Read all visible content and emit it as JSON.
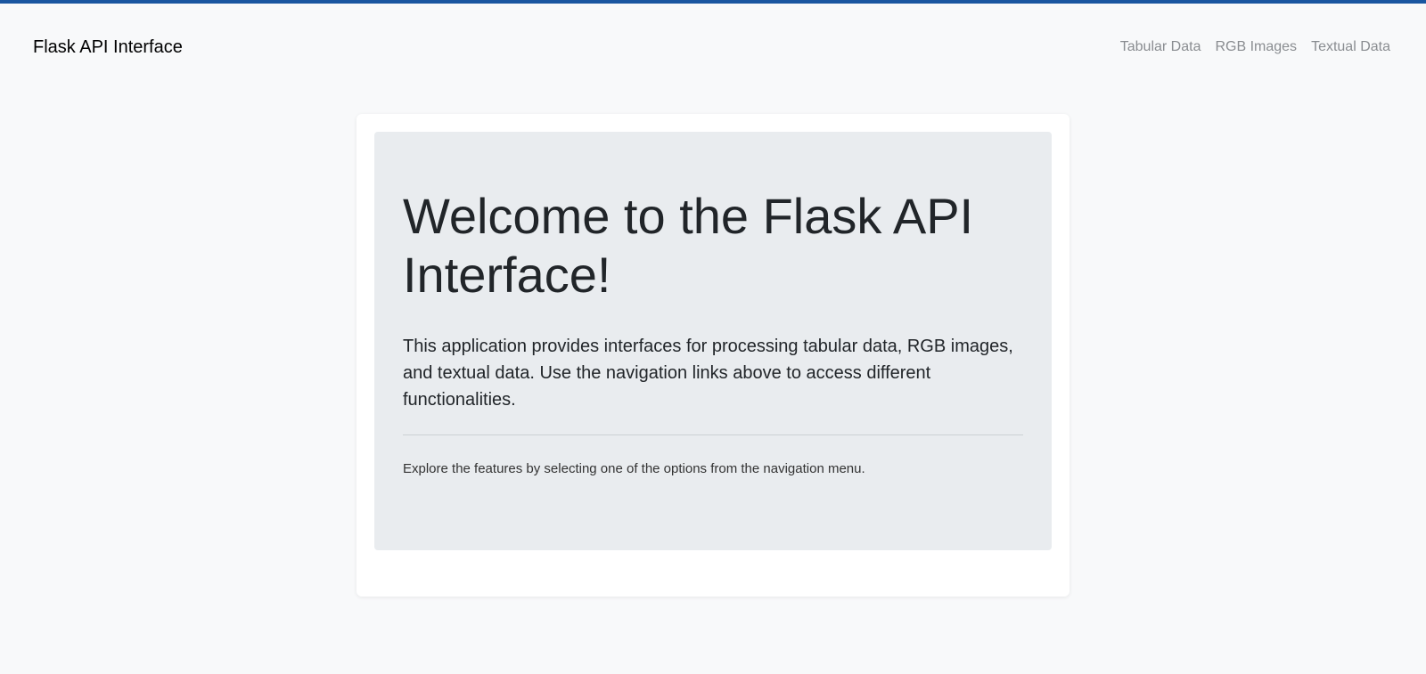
{
  "navbar": {
    "brand": "Flask API Interface",
    "links": [
      "Tabular Data",
      "RGB Images",
      "Textual Data"
    ]
  },
  "main": {
    "title": "Welcome to the Flask API Interface!",
    "lead": "This application provides interfaces for processing tabular data, RGB images, and textual data. Use the navigation links above to access different functionalities.",
    "note": "Explore the features by selecting one of the options from the navigation menu."
  },
  "colors": {
    "accent": "#1a56a0",
    "background": "#f8f9fa",
    "jumbotron": "#e9ecef"
  }
}
